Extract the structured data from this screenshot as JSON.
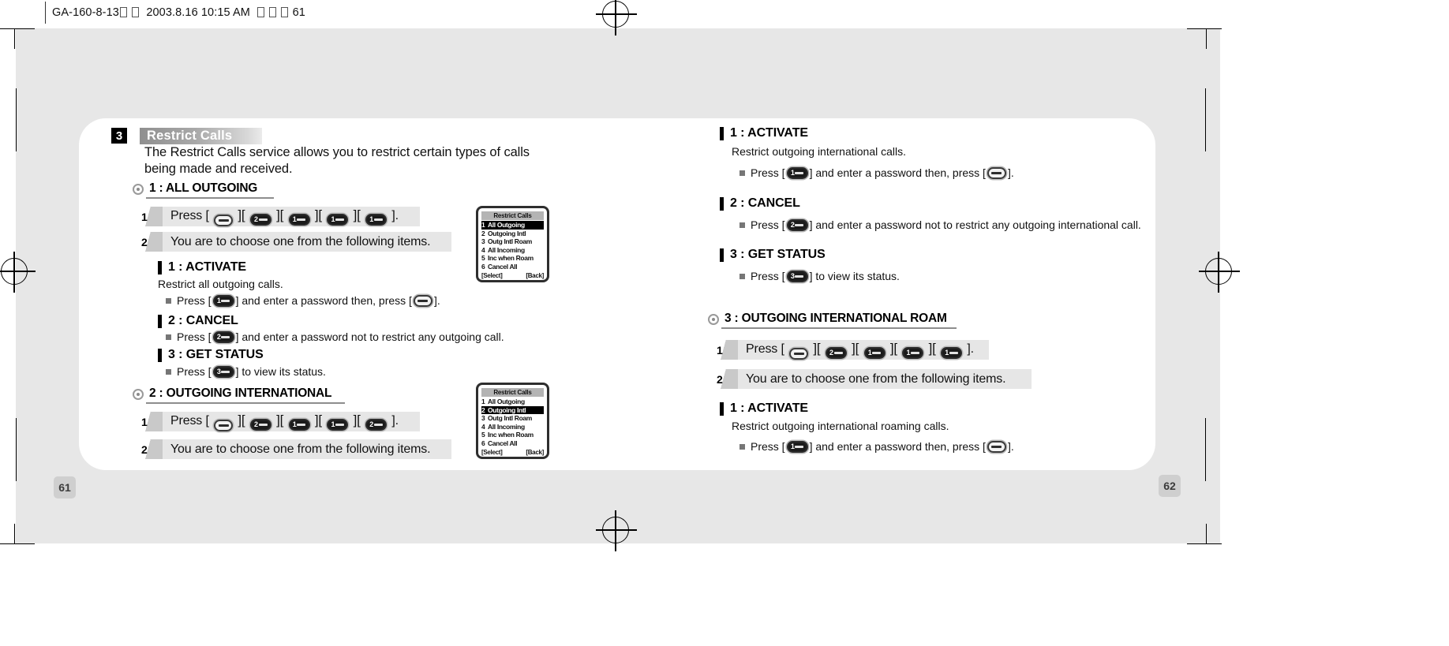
{
  "print_header": {
    "doc_code": "GA-160-8-13",
    "timestamp": "2003.8.16 10:15 AM",
    "page_ref": "61"
  },
  "pages": {
    "left_number": "61",
    "right_number": "62"
  },
  "section": {
    "badge": "3",
    "title": "Restrict Calls",
    "intro_line1": "The Restrict Calls service allows you to restrict certain types of calls",
    "intro_line2": "being made and received."
  },
  "sub_sections": {
    "all_outgoing": {
      "head": "1 : ALL OUTGOING",
      "step1_num": "1",
      "step1_text_prefix": "Press [",
      "step1_keys": [
        "ok",
        "2",
        "1",
        "1",
        "1"
      ],
      "step1_text_suffix": "].",
      "step2_num": "2",
      "step2_text": "You are to choose one from the following items.",
      "items": [
        {
          "head": "1 : ACTIVATE",
          "desc": "Restrict all outgoing calls.",
          "bullet_pre": "Press [",
          "bullet_key": "1",
          "bullet_mid": "] and enter a password then, press [",
          "bullet_key2": "ok",
          "bullet_post": "]."
        },
        {
          "head": "2 : CANCEL",
          "desc": "",
          "bullet_pre": "Press [",
          "bullet_key": "2",
          "bullet_mid": "] and enter a password not to restrict any outgoing call.",
          "bullet_key2": "",
          "bullet_post": ""
        },
        {
          "head": "3 : GET STATUS",
          "desc": "",
          "bullet_pre": "Press [",
          "bullet_key": "3",
          "bullet_mid": "] to view its status.",
          "bullet_key2": "",
          "bullet_post": ""
        }
      ]
    },
    "outgoing_intl": {
      "head": "2 : OUTGOING INTERNATIONAL",
      "step1_num": "1",
      "step1_text_prefix": "Press [",
      "step1_keys": [
        "ok",
        "2",
        "1",
        "1",
        "2"
      ],
      "step1_text_suffix": "].",
      "step2_num": "2",
      "step2_text": "You are to choose one from the following items.",
      "items": [
        {
          "head": "1 : ACTIVATE",
          "desc": "Restrict outgoing international calls.",
          "bullet_pre": "Press [",
          "bullet_key": "1",
          "bullet_mid": "] and enter a password then, press [",
          "bullet_key2": "ok",
          "bullet_post": "]."
        },
        {
          "head": "2 : CANCEL",
          "desc": "",
          "bullet_pre": "Press [",
          "bullet_key": "2",
          "bullet_mid": "] and enter a password not to restrict any outgoing international call.",
          "bullet_key2": "",
          "bullet_post": ""
        },
        {
          "head": "3 : GET STATUS",
          "desc": "",
          "bullet_pre": "Press [",
          "bullet_key": "3",
          "bullet_mid": "] to view its status.",
          "bullet_key2": "",
          "bullet_post": ""
        }
      ]
    },
    "outgoing_intl_roam": {
      "head": "3 : OUTGOING INTERNATIONAL ROAM",
      "step1_num": "1",
      "step1_text_prefix": "Press [",
      "step1_keys": [
        "ok",
        "2",
        "1",
        "1",
        "1"
      ],
      "step1_text_suffix": "].",
      "step2_num": "2",
      "step2_text": "You are to choose one from the following items.",
      "items": [
        {
          "head": "1 : ACTIVATE",
          "desc": "Restrict outgoing international roaming calls.",
          "bullet_pre": "Press [",
          "bullet_key": "1",
          "bullet_mid": "] and enter a password then, press [",
          "bullet_key2": "ok",
          "bullet_post": "]."
        }
      ]
    }
  },
  "phone_screens": [
    {
      "title": "Restrict Calls",
      "items": [
        {
          "n": "1",
          "label": "All Outgoing",
          "selected": true
        },
        {
          "n": "2",
          "label": "Outgoing Intl",
          "selected": false
        },
        {
          "n": "3",
          "label": "Outg Intl Roam",
          "selected": false
        },
        {
          "n": "4",
          "label": "All Incoming",
          "selected": false
        },
        {
          "n": "5",
          "label": "Inc when Roam",
          "selected": false
        },
        {
          "n": "6",
          "label": "Cancel All",
          "selected": false
        }
      ],
      "softkey_left": "[Select]",
      "softkey_right": "[Back]"
    },
    {
      "title": "Restrict Calls",
      "items": [
        {
          "n": "1",
          "label": "All Outgoing",
          "selected": false
        },
        {
          "n": "2",
          "label": "Outgoing Intl",
          "selected": true
        },
        {
          "n": "3",
          "label": "Outg Intl Roam",
          "selected": false
        },
        {
          "n": "4",
          "label": "All Incoming",
          "selected": false
        },
        {
          "n": "5",
          "label": "Inc when Roam",
          "selected": false
        },
        {
          "n": "6",
          "label": "Cancel All",
          "selected": false
        }
      ],
      "softkey_left": "[Select]",
      "softkey_right": "[Back]"
    }
  ],
  "colors": {
    "page_bg": "#e7e7e7",
    "panel": "#ffffff",
    "step_bar": "#e6e6e6",
    "title_bar_start": "#8f8f8f",
    "accent_dark": "#000000"
  }
}
